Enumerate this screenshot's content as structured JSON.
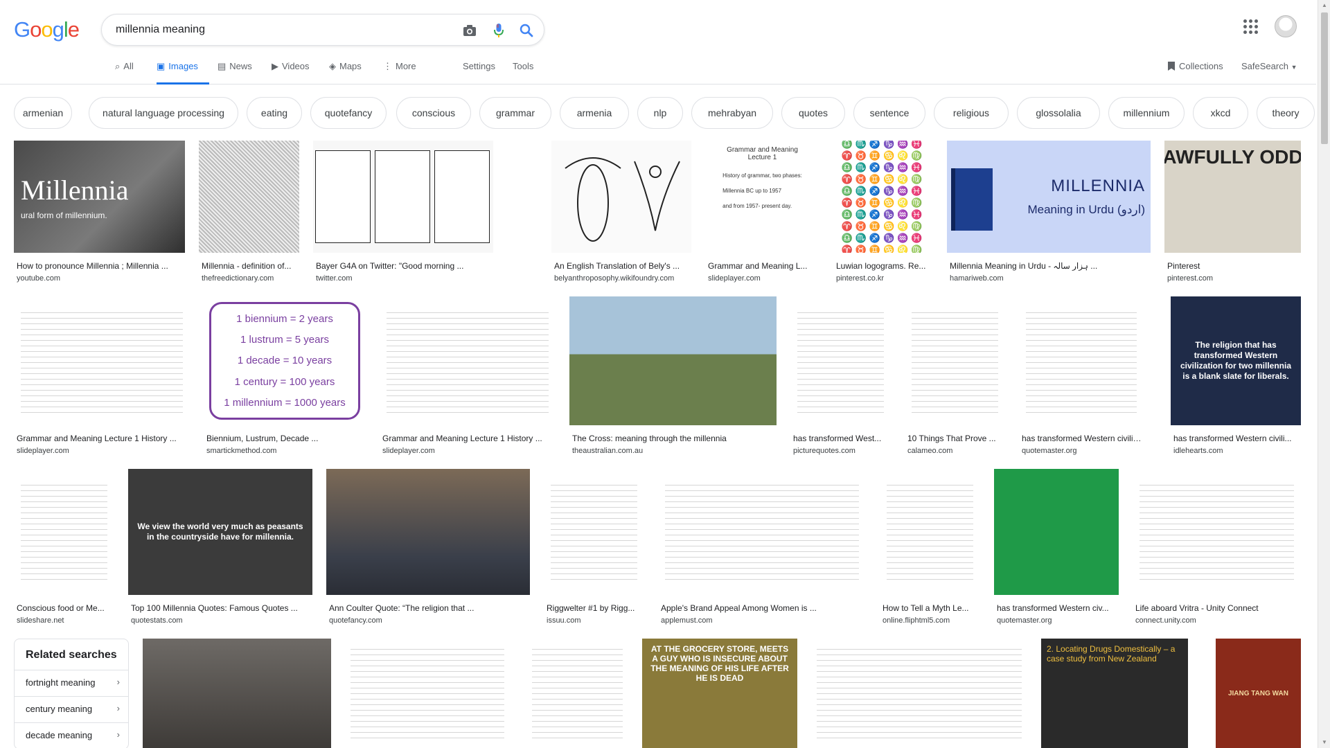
{
  "logo": {
    "letters": [
      "G",
      "o",
      "o",
      "g",
      "l",
      "e"
    ],
    "colors": [
      "#4285f4",
      "#ea4335",
      "#fbbc05",
      "#4285f4",
      "#34a853",
      "#ea4335"
    ]
  },
  "search": {
    "query": "millennia meaning"
  },
  "tabs": [
    {
      "label": "All",
      "icon": "search-icon",
      "glyph": "⌕"
    },
    {
      "label": "Images",
      "icon": "image-icon",
      "glyph": "▣",
      "active": true
    },
    {
      "label": "News",
      "icon": "news-icon",
      "glyph": "▤"
    },
    {
      "label": "Videos",
      "icon": "video-icon",
      "glyph": "▶"
    },
    {
      "label": "Maps",
      "icon": "map-icon",
      "glyph": "◈"
    },
    {
      "label": "More",
      "icon": "more-vert-icon",
      "glyph": "⋮"
    }
  ],
  "settings_label": "Settings",
  "tools_label": "Tools",
  "collections_label": "Collections",
  "safesearch_label": "SafeSearch",
  "chips": [
    "armenian",
    "natural language processing",
    "eating",
    "quotefancy",
    "conscious",
    "grammar",
    "armenia",
    "nlp",
    "mehrabyan",
    "quotes",
    "sentence",
    "religious",
    "glossolalia",
    "millennium",
    "xkcd",
    "theory"
  ],
  "results": [
    {
      "title": "How to pronounce Millennia ; Millennia ...",
      "source": "youtube.com",
      "thumb_text": "Millennia",
      "thumb_sub": "ural form of millennium."
    },
    {
      "title": "Millennia - definition of...",
      "source": "thefreedictionary.com",
      "thumb_text": "",
      "thumb_sub": ""
    },
    {
      "title": "Bayer G4A on Twitter: \"Good morning ...",
      "source": "twitter.com",
      "thumb_text": "",
      "thumb_sub": ""
    },
    {
      "title": "An English Translation of Bely's ...",
      "source": "belyanthroposophy.wikifoundry.com",
      "thumb_text": "",
      "thumb_sub": ""
    },
    {
      "title": "Grammar and Meaning L...",
      "source": "slideplayer.com",
      "thumb_text": "Grammar and Meaning\nLecture 1",
      "thumb_sub": "History of grammar, two phases:\nMillennia BC up to 1957\nand from 1957- present day."
    },
    {
      "title": "Luwian logograms. Re...",
      "source": "pinterest.co.kr",
      "thumb_text": "",
      "thumb_sub": ""
    },
    {
      "title": "Millennia Meaning in Urdu - ہزار سالہ ...",
      "source": "hamariweb.com",
      "thumb_text": "MILLENNIA",
      "thumb_sub": "Meaning in Urdu (اردو)"
    },
    {
      "title": "Pinterest",
      "source": "pinterest.com",
      "thumb_text": "AWFULLY ODD",
      "thumb_sub": ""
    },
    {
      "title": "Grammar and Meaning Lecture 1 History ...",
      "source": "slideplayer.com",
      "thumb_text": "",
      "thumb_sub": ""
    },
    {
      "title": "Biennium, Lustrum, Decade ...",
      "source": "smartickmethod.com",
      "thumb_text": "",
      "thumb_sub": "",
      "lines": [
        "1 biennium = 2 years",
        "1 lustrum = 5 years",
        "1 decade = 10 years",
        "1 century = 100 years",
        "1 millennium = 1000 years"
      ]
    },
    {
      "title": "Grammar and Meaning Lecture 1 History ...",
      "source": "slideplayer.com",
      "thumb_text": "",
      "thumb_sub": ""
    },
    {
      "title": "The Cross: meaning through the millennia",
      "source": "theaustralian.com.au",
      "thumb_text": "",
      "thumb_sub": ""
    },
    {
      "title": "has transformed West...",
      "source": "picturequotes.com",
      "thumb_text": "",
      "thumb_sub": ""
    },
    {
      "title": "10 Things That Prove ...",
      "source": "calameo.com",
      "thumb_text": "",
      "thumb_sub": ""
    },
    {
      "title": "has transformed Western civiliz...",
      "source": "quotemaster.org",
      "thumb_text": "",
      "thumb_sub": ""
    },
    {
      "title": "has transformed Western civili...",
      "source": "idlehearts.com",
      "thumb_text": "The religion that has transformed Western civilization for two millennia is a blank slate for liberals.",
      "thumb_sub": ""
    },
    {
      "title": "Conscious food or Me...",
      "source": "slideshare.net",
      "thumb_text": "",
      "thumb_sub": ""
    },
    {
      "title": "Top 100 Millennia Quotes: Famous Quotes ...",
      "source": "quotestats.com",
      "thumb_text": "We view the world very much as peasants in the countryside have for millennia.",
      "thumb_sub": ""
    },
    {
      "title": "Ann Coulter Quote: “The religion that ...",
      "source": "quotefancy.com",
      "thumb_text": "",
      "thumb_sub": ""
    },
    {
      "title": "Riggwelter #1 by Rigg...",
      "source": "issuu.com",
      "thumb_text": "",
      "thumb_sub": ""
    },
    {
      "title": "Apple's Brand Appeal Among Women is ...",
      "source": "applemust.com",
      "thumb_text": "",
      "thumb_sub": ""
    },
    {
      "title": "How to Tell a Myth Le...",
      "source": "online.fliphtml5.com",
      "thumb_text": "",
      "thumb_sub": ""
    },
    {
      "title": "has transformed Western civ...",
      "source": "quotemaster.org",
      "thumb_text": "",
      "thumb_sub": ""
    },
    {
      "title": "Life aboard Vritra - Unity Connect",
      "source": "connect.unity.com",
      "thumb_text": "",
      "thumb_sub": ""
    }
  ],
  "bottom_thumbs": [
    {
      "text": ""
    },
    {
      "text": ""
    },
    {
      "text": ""
    },
    {
      "text": "AT THE GROCERY STORE, MEETS A GUY WHO IS INSECURE ABOUT THE MEANING OF HIS LIFE AFTER HE IS DEAD"
    },
    {
      "text": ""
    },
    {
      "text": "2. Locating Drugs Domestically – a case study from New Zealand"
    },
    {
      "text": "JIANG TANG WAN"
    }
  ],
  "related": {
    "title": "Related searches",
    "items": [
      "fortnight meaning",
      "century meaning",
      "decade meaning"
    ]
  }
}
